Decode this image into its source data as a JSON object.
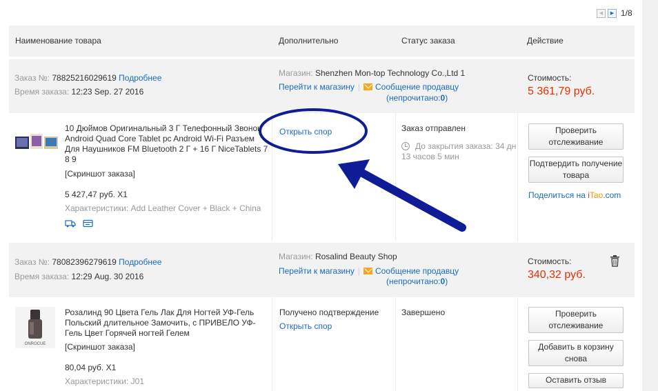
{
  "pager": {
    "text": "1/8"
  },
  "table_header": {
    "product": "Наименование товара",
    "extra": "Дополнительно",
    "status": "Статус заказа",
    "action": "Действие"
  },
  "orders": [
    {
      "order_label": "Заказ №:",
      "order_number": "78825216029619",
      "details_link": "Подробнее",
      "time_label": "Время заказа:",
      "time_value": "12:23 Sep. 27 2016",
      "store_label": "Магазин:",
      "store_name": "Shenzhen Mon-top Technology Co.,Ltd 1",
      "store_link": "Перейти к магазину",
      "message_link": "Сообщение продавцу",
      "unread_open": "(непрочитано:",
      "unread_count": "0",
      "unread_close": ")",
      "cost_label": "Стоимость:",
      "cost_value": "5 361,79 руб.",
      "item": {
        "title": "10 Дюймов Оригинальный 3 Г Телефонный Звонок Android Quad Core Tablet pc Android Wi-Fi Разъем Для Наушников FM Bluetooth 2 Г + 16 Г NiceTablets 7 8 9",
        "snapshot": "[Скриншот заказа]",
        "price": "5 427,47 руб. X1",
        "specs": "Характеристики: Add Leather Cover + Black + China",
        "extra_link": "Открыть спор",
        "status": "Заказ отправлен",
        "deadline": "До закрытия заказа: 34 дн 13 часов 5 мин",
        "btn_track": "Проверить отслеживание",
        "btn_confirm": "Подтвердить получение товара",
        "share_text": "Поделиться на ",
        "share_brand_i": "i",
        "share_brand_tao": "Tao",
        "share_brand_com": ".com"
      }
    },
    {
      "order_label": "Заказ №:",
      "order_number": "78082396279619",
      "details_link": "Подробнее",
      "time_label": "Время заказа:",
      "time_value": "12:29 Aug. 30 2016",
      "store_label": "Магазин:",
      "store_name": "Rosalind Beauty Shop",
      "store_link": "Перейти к магазину",
      "message_link": "Сообщение продавцу",
      "unread_open": "(непрочитано:",
      "unread_count": "0",
      "unread_close": ")",
      "cost_label": "Стоимость:",
      "cost_value": "340,32 руб.",
      "item": {
        "title": "Розалинд 90 Цвета Гель Лак Для Ногтей УФ-Гель Польский длительное Замочить, с ПРИВЕЛО УФ-Гель Цвет Горячей ногтей Гелем",
        "snapshot": "[Скриншот заказа]",
        "price": "80,04 руб. X1",
        "specs": "Характеристики: J01",
        "extra_status": "Получено подтверждение",
        "extra_link": "Открыть спор",
        "status": "Завершено",
        "btn_track": "Проверить отслеживание",
        "btn_cart": "Добавить в корзину снова",
        "btn_review": "Оставить отзыв"
      }
    }
  ],
  "colors": {
    "link": "#1a6bbf",
    "price": "#e62e04",
    "annotation": "#101c96"
  }
}
